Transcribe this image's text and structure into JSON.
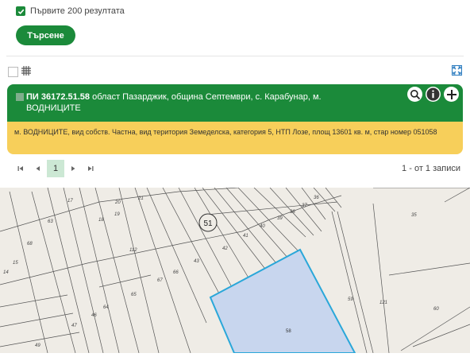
{
  "options": {
    "first_results_label": "Първите 200 резултата",
    "first_results_checked": true
  },
  "search": {
    "button_label": "Търсене"
  },
  "result": {
    "title_bold": "ПИ 36172.51.58",
    "title_rest": " област Пазарджик, община Септември, с. Карабунар, м. ВОДНИЦИТЕ",
    "details": "м. ВОДНИЦИТЕ, вид собств. Частна, вид територия Земеделска, категория 5, НТП Лозе, площ 13601 кв. м, стар номер 051058",
    "header_color": "#1b8a3a",
    "body_color": "#f7cf5a"
  },
  "pager": {
    "current_page": "1",
    "summary": "1 - от 1 записи"
  },
  "map": {
    "zone_label": "51",
    "selected_parcel_label": "58",
    "highlight_fill": "#c8d6ee",
    "highlight_stroke": "#2aa7d9",
    "parcel_labels": [
      "17",
      "20",
      "21",
      "19",
      "18",
      "63",
      "68",
      "15",
      "14",
      "112",
      "67",
      "66",
      "65",
      "64",
      "46",
      "47",
      "49",
      "43",
      "42",
      "41",
      "40",
      "39",
      "38",
      "37",
      "36",
      "35",
      "59",
      "60",
      "121"
    ]
  }
}
